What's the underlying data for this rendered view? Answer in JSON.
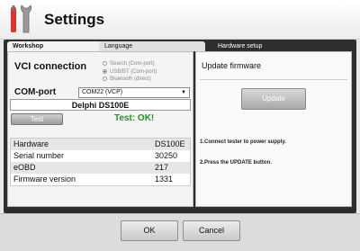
{
  "window": {
    "title": "Settings",
    "icon": "wrench-screwdriver-icon"
  },
  "tabs": [
    {
      "label": "Workshop",
      "active": false
    },
    {
      "label": "Language",
      "active": false
    },
    {
      "label": "Hardware setup",
      "active": true
    }
  ],
  "vci": {
    "label": "VCI connection",
    "options": [
      {
        "label": "Search (Com-port)",
        "selected": false
      },
      {
        "label": "USB/BT (Com-port)",
        "selected": true
      },
      {
        "label": "Bluetooth (direct)",
        "selected": false
      }
    ]
  },
  "comport": {
    "label": "COM-port",
    "value": "COM22 (VCP)"
  },
  "device": {
    "name": "Delphi DS100E"
  },
  "test": {
    "button_label": "Test",
    "result": "Test: OK!",
    "result_color": "#1a9a1a"
  },
  "info_rows": [
    {
      "key": "Hardware",
      "value": "DS100E"
    },
    {
      "key": "Serial number",
      "value": "30250"
    },
    {
      "key": "eOBD",
      "value": "217"
    },
    {
      "key": "Firmware version",
      "value": "1331"
    }
  ],
  "update": {
    "title": "Update firmware",
    "button_label": "Update",
    "step1": "1.Connect tester to power supply.",
    "step2": "2.Press the UPDATE button."
  },
  "footer": {
    "ok_label": "OK",
    "cancel_label": "Cancel"
  }
}
